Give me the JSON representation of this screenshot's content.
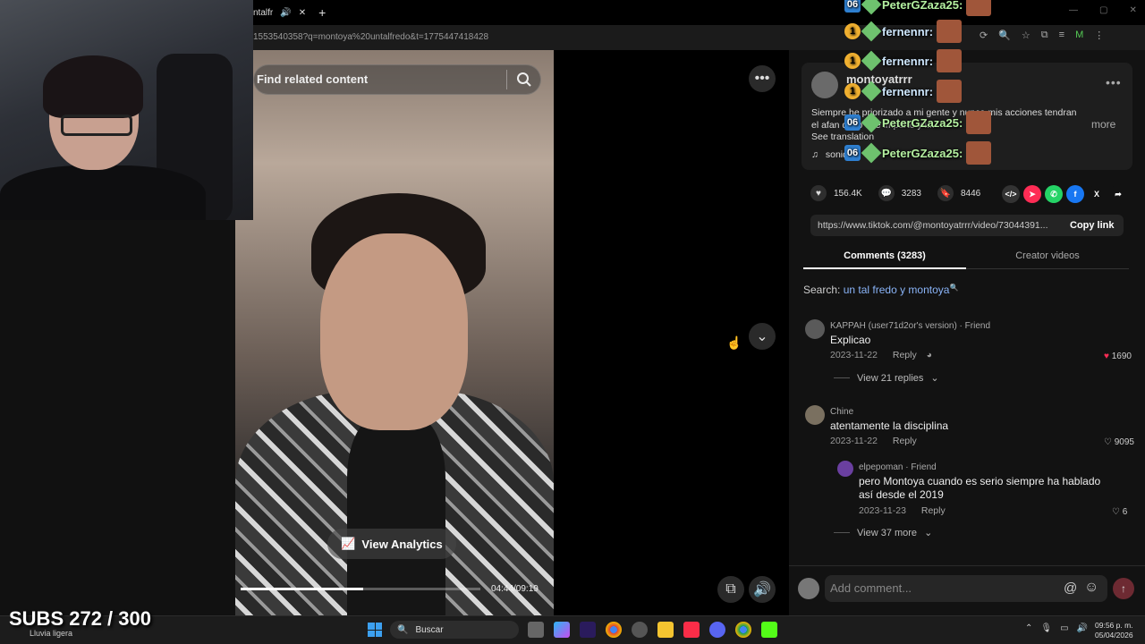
{
  "browser": {
    "tab_title": "ntalfr",
    "tab_add": "+",
    "url": "1553540358?q=montoya%20untalfredo&t=1775447418428"
  },
  "video": {
    "search_placeholder": "Find related content",
    "view_analytics_label": "View Analytics",
    "timecode": "04:44/09:19",
    "progress": 0.51
  },
  "post": {
    "author_handle": "montoyatrrr",
    "author_sub": "M",
    "description": "Siempre he priorizado a mi gente y nunca mis acciones tendran el afan de lo que imparto y l...",
    "see_translation": "See translation",
    "more_label": "more",
    "music": "sonido",
    "likes": "156.4K",
    "comments": "3283",
    "saves": "8446",
    "link": "https://www.tiktok.com/@montoyatrrr/video/73044391...",
    "copy_link_label": "Copy link"
  },
  "tabs": {
    "comments": "Comments (3283)",
    "creator_videos": "Creator videos"
  },
  "search": {
    "prefix": "Search:",
    "query": "un tal fredo y montoya"
  },
  "comments": [
    {
      "name": "KAPPAH (user71d2or's version) · Friend",
      "text": "Explicao",
      "date": "2023-11-22",
      "reply": "Reply",
      "likes": "1690",
      "view_replies": "View 21 replies"
    },
    {
      "name": "Chine",
      "text": "atentamente la disciplina",
      "date": "2023-11-22",
      "reply": "Reply",
      "likes": "9095"
    },
    {
      "name": "elpepoman · Friend",
      "text_line1": "pero Montoya cuando es serio siempre ha hablado",
      "text_line2": "así desde el 2019",
      "date": "2023-11-23",
      "reply": "Reply",
      "likes": "6",
      "view_more": "View 37 more"
    }
  ],
  "add_comment": {
    "placeholder": "Add comment...",
    "at": "@"
  },
  "chat": [
    {
      "badge": "1",
      "name": "fernennr:"
    },
    {
      "badge": "1",
      "name": "fernennr:"
    },
    {
      "badge": "1",
      "name": "fernennr:"
    },
    {
      "badge": "06",
      "name": "PeterGZaza25:"
    },
    {
      "badge": "06",
      "name": "PeterGZaza25:"
    },
    {
      "badge": "06",
      "name": "PeterGZaza25:"
    }
  ],
  "overlay": {
    "subs": "SUBS 272 / 300"
  },
  "taskbar": {
    "weather": "Lluvia ligera",
    "search": "Buscar",
    "time": "09:56 p. m.",
    "date": "05/04/2026"
  },
  "colors": {
    "like_red": "#fe2c55",
    "link_blue": "#8ab4f8"
  }
}
